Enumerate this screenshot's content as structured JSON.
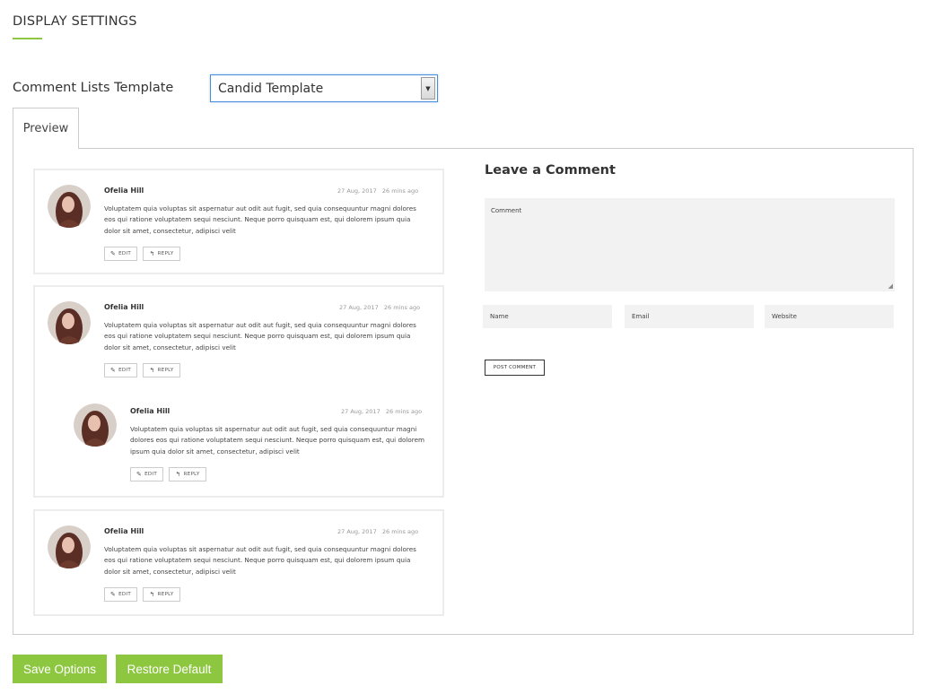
{
  "section": {
    "title": "DISPLAY SETTINGS"
  },
  "template_field": {
    "label": "Comment Lists Template",
    "selected": "Candid Template",
    "arrow_icon": "▼"
  },
  "tab": {
    "label": "Preview"
  },
  "comments": {
    "name": "Ofelia Hill",
    "date": "27 Aug, 2017",
    "ago": "26 mins ago",
    "text": "Voluptatem quia voluptas sit aspernatur aut odit aut fugit, sed quia consequuntur magni dolores eos qui ratione voluptatem sequi nesciunt. Neque porro quisquam est, qui dolorem ipsum quia dolor sit amet, consectetur, adipisci velit",
    "edit_label": "EDIT",
    "reply_label": "REPLY",
    "edit_icon": "✎",
    "reply_icon": "↰"
  },
  "leave_comment": {
    "title": "Leave a Comment",
    "comment_placeholder": "Comment",
    "name_placeholder": "Name",
    "email_placeholder": "Email",
    "website_placeholder": "Website",
    "post_label": "POST COMMENT"
  },
  "buttons": {
    "save": "Save Options",
    "restore": "Restore Default"
  },
  "colors": {
    "accent": "#8dc63f",
    "focus": "#4a90d9"
  }
}
